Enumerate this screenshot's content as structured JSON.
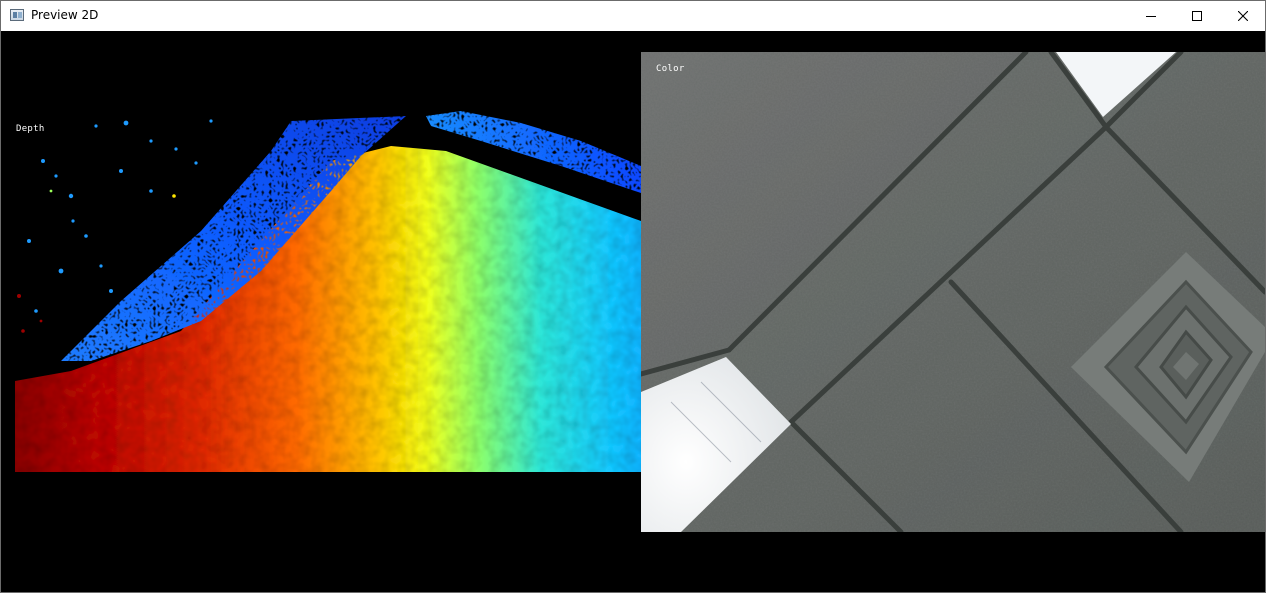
{
  "window": {
    "title": "Preview 2D",
    "controls": {
      "minimize": "minimize-icon",
      "maximize": "maximize-icon",
      "close": "close-icon"
    }
  },
  "views": {
    "depth": {
      "label": "Depth"
    },
    "color": {
      "label": "Color"
    }
  }
}
